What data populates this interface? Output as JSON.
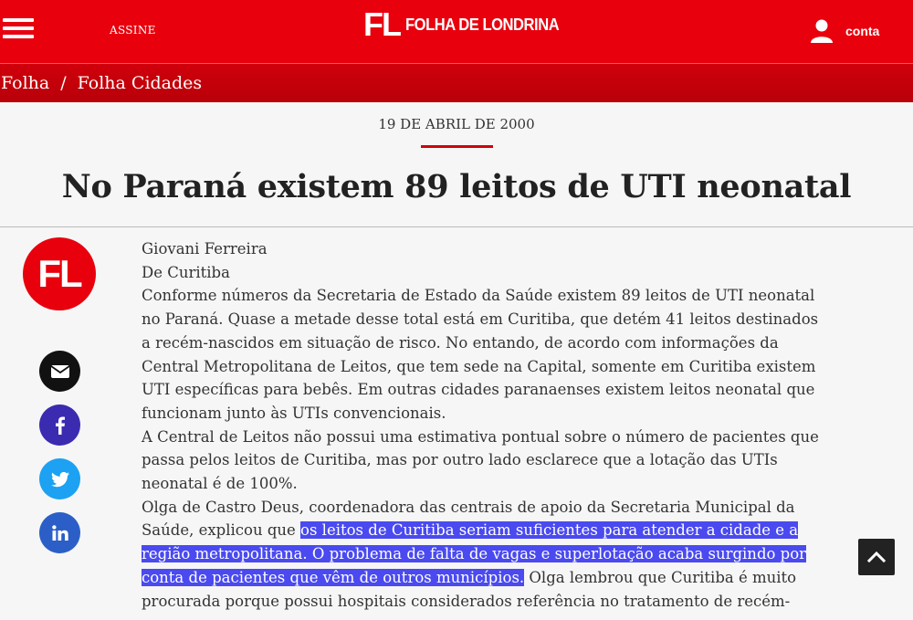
{
  "header": {
    "subscribe_label": "ASSINE",
    "brand_mark": "FL",
    "brand_name": "FOLHA DE LONDRINA",
    "account_label": "conta"
  },
  "breadcrumb": {
    "items": [
      "Folha",
      "Folha Cidades"
    ],
    "separator": "/"
  },
  "article": {
    "date": "19 DE ABRIL DE 2000",
    "title": "No Paraná existem 89 leitos de UTI neonatal",
    "author_logo": "FL",
    "author": "Giovani Ferreira",
    "location": "De Curitiba",
    "paragraph_1": "Conforme números da Secretaria de Estado da Saúde existem 89 leitos de UTI neonatal no Paraná. Quase a metade desse total está em Curitiba, que detém 41 leitos destinados a recém-nascidos em situação de risco. No entando, de acordo com informações da Central Metropolitana de Leitos, que tem sede na Capital, somente em Curitiba existem UTI específicas para bebês. Em outras cidades paranaenses existem leitos neonatal que funcionam junto às UTIs convencionais.",
    "paragraph_2": "A Central de Leitos não possui uma estimativa pontual sobre o número de pacientes que passa pelos leitos de Curitiba, mas por outro lado esclarece que a lotação das UTIs neonatal é de 100%.",
    "paragraph_3_before": "Olga de Castro Deus, coordenadora das centrais de apoio da Secretaria Municipal da Saúde, explicou que ",
    "paragraph_3_highlight": "os leitos de Curitiba seriam suficientes para atender a cidade e a região metropolitana. O problema de falta de vagas e superlotação acaba surgindo por conta de pacientes que vêm de outros municípios.",
    "paragraph_3_after": " Olga lembrou que Curitiba é muito procurada porque possui hospitais considerados referência no tratamento de recém-"
  },
  "share": {
    "icons": [
      "email-icon",
      "facebook-icon",
      "twitter-icon",
      "linkedin-icon"
    ]
  },
  "colors": {
    "brand_red": "#e8000d",
    "breadcrumb_red": "#c4000b",
    "highlight": "#4a4af0"
  }
}
